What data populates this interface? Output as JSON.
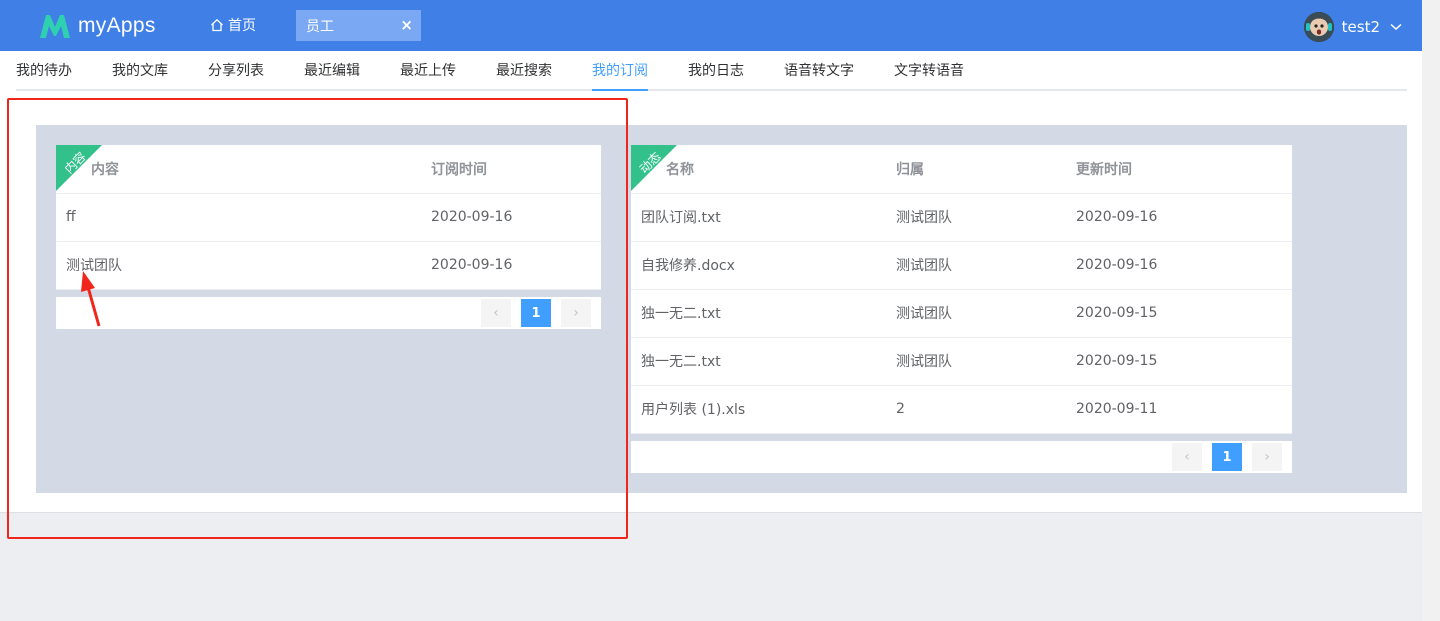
{
  "header": {
    "logo_text": "myApps",
    "home_label": "首页",
    "active_tab_label": "员工",
    "close_symbol": "×",
    "username": "test2"
  },
  "subnav": {
    "items": [
      "我的待办",
      "我的文库",
      "分享列表",
      "最近编辑",
      "最近上传",
      "最近搜索",
      "我的订阅",
      "我的日志",
      "语音转文字",
      "文字转语音"
    ],
    "active": "我的订阅"
  },
  "left_card": {
    "ribbon": "内容",
    "columns": [
      "内容",
      "订阅时间"
    ],
    "rows": [
      [
        "ff",
        "2020-09-16"
      ],
      [
        "测试团队",
        "2020-09-16"
      ]
    ],
    "pager": {
      "prev": "‹",
      "current": "1",
      "next": "›"
    }
  },
  "right_card": {
    "ribbon": "动态",
    "columns": [
      "名称",
      "归属",
      "更新时间"
    ],
    "rows": [
      [
        "团队订阅.txt",
        "测试团队",
        "2020-09-16"
      ],
      [
        "自我修养.docx",
        "测试团队",
        "2020-09-16"
      ],
      [
        "独一无二.txt",
        "测试团队",
        "2020-09-15"
      ],
      [
        "独一无二.txt",
        "测试团队",
        "2020-09-15"
      ],
      [
        "用户列表 (1).xls",
        "2",
        "2020-09-11"
      ]
    ],
    "pager": {
      "prev": "‹",
      "current": "1",
      "next": "›"
    }
  },
  "colors": {
    "header_bg": "#3f7fe6",
    "accent": "#409eff",
    "ribbon": "#32c08b",
    "annotation": "#f0261d",
    "panel_bg": "#d3dae5"
  },
  "icons": {
    "home": "home-icon",
    "close": "close-icon",
    "dropdown": "chevron-down-icon",
    "logo": "logo-m-icon"
  }
}
